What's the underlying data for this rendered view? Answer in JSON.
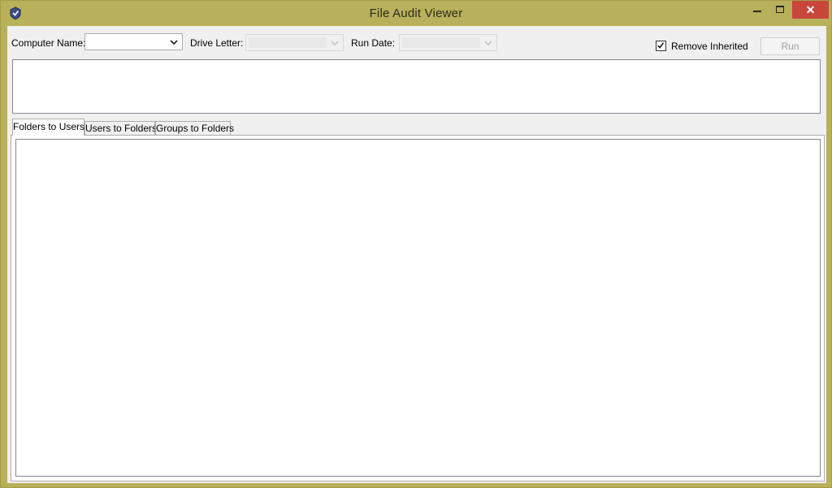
{
  "window": {
    "title": "File Audit Viewer",
    "icons": {
      "app": "app-shield-icon",
      "minimize": "minimize-icon",
      "maximize": "maximize-icon",
      "close": "close-icon"
    },
    "close_glyph": "✕"
  },
  "toolbar": {
    "computer_name_label": "Computer Name:",
    "computer_name_value": "",
    "drive_letter_label": "Drive Letter:",
    "drive_letter_value": "",
    "run_date_label": "Run Date:",
    "run_date_value": "",
    "remove_inherited_label": "Remove Inherited",
    "remove_inherited_checked": true,
    "run_label": "Run"
  },
  "tabs": [
    {
      "label": "Folders to Users",
      "active": true
    },
    {
      "label": "Users to Folders",
      "active": false
    },
    {
      "label": "Groups to Folders",
      "active": false
    }
  ],
  "colors": {
    "frame": "#b8b05a",
    "close_button": "#c9463d",
    "client_background": "#f0f0f0"
  }
}
